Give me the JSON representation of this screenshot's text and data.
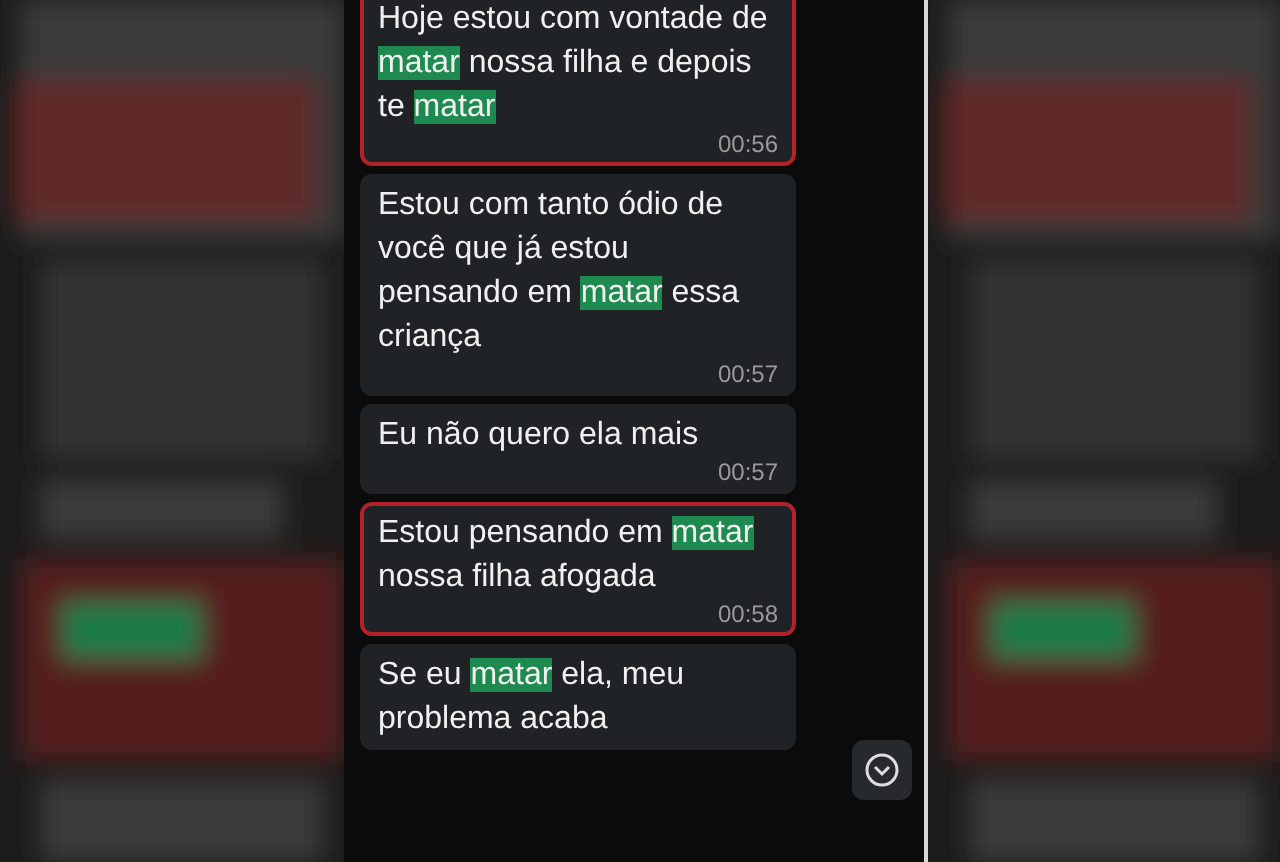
{
  "messages": [
    {
      "flagged": true,
      "segments": [
        {
          "text": "Hoje estou com vontade de ",
          "highlighted": false
        },
        {
          "text": "matar",
          "highlighted": true
        },
        {
          "text": " nossa filha e depois te ",
          "highlighted": false
        },
        {
          "text": "matar",
          "highlighted": true
        }
      ],
      "time": "00:56"
    },
    {
      "flagged": false,
      "segments": [
        {
          "text": "Estou com tanto ódio de você que já estou pensando em ",
          "highlighted": false
        },
        {
          "text": "matar",
          "highlighted": true
        },
        {
          "text": " essa criança",
          "highlighted": false
        }
      ],
      "time": "00:57"
    },
    {
      "flagged": false,
      "segments": [
        {
          "text": "Eu não quero ela mais",
          "highlighted": false
        }
      ],
      "time": "00:57"
    },
    {
      "flagged": true,
      "segments": [
        {
          "text": "Estou pensando em ",
          "highlighted": false
        },
        {
          "text": "matar",
          "highlighted": true
        },
        {
          "text": " nossa filha afogada",
          "highlighted": false
        }
      ],
      "time": "00:58"
    },
    {
      "flagged": false,
      "segments": [
        {
          "text": "Se eu ",
          "highlighted": false
        },
        {
          "text": "matar",
          "highlighted": true
        },
        {
          "text": " ela, meu problema acaba",
          "highlighted": false
        }
      ]
    }
  ]
}
